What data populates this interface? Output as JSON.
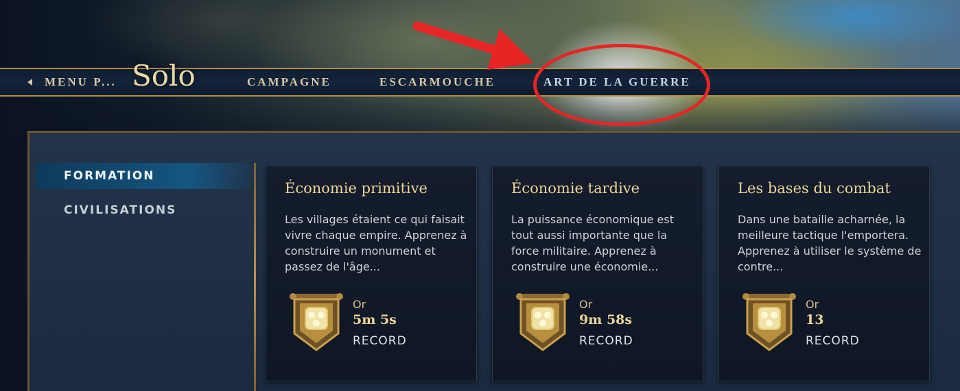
{
  "nav": {
    "back_label": "MENU P...",
    "title": "Solo",
    "tabs": [
      {
        "label": "CAMPAGNE"
      },
      {
        "label": "ESCARMOUCHE"
      },
      {
        "label": "ART DE LA GUERRE"
      }
    ]
  },
  "sidebar": {
    "items": [
      {
        "label": "FORMATION"
      },
      {
        "label": "CIVILISATIONS"
      }
    ]
  },
  "cards": [
    {
      "title": "Économie primitive",
      "description": "Les villages étaient ce qui faisait vivre chaque empire. Apprenez à construire un monument et passez de l'âge...",
      "medal": "Or",
      "value": "5m 5s",
      "record_label": "RECORD"
    },
    {
      "title": "Économie tardive",
      "description": "La puissance économique est tout aussi importante que la force militaire. Apprenez à construire une économie...",
      "medal": "Or",
      "value": "9m 58s",
      "record_label": "RECORD"
    },
    {
      "title": "Les bases du combat",
      "description": "Dans une bataille acharnée, la meilleure tactique l'emportera. Apprenez à utiliser le système de contre...",
      "medal": "Or",
      "value": "13",
      "record_label": "RECORD"
    }
  ],
  "colors": {
    "accent_gold": "#ecd596",
    "annotation_red": "#e82525",
    "active_tab_blue": "#145680"
  },
  "icons": [
    "back-arrow-icon",
    "gold-medal-banner-icon"
  ]
}
